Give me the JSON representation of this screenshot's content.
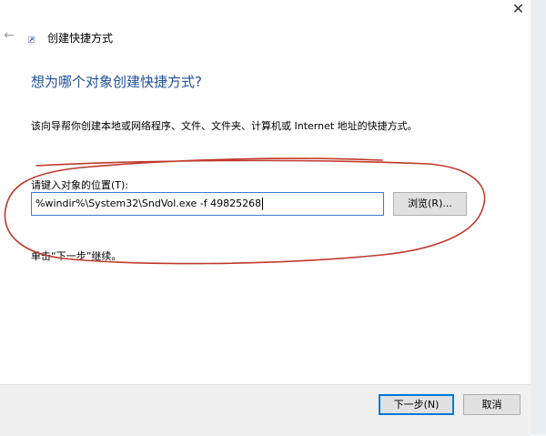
{
  "window": {
    "title": "创建快捷方式",
    "close_glyph": "✕",
    "back_glyph": "←"
  },
  "main": {
    "heading": "想为哪个对象创建快捷方式?",
    "description": "该向导帮你创建本地或网络程序、文件、文件夹、计算机或 Internet 地址的快捷方式。",
    "field_label": "请键入对象的位置(T):",
    "field_value": "%windir%\\System32\\SndVol.exe -f 49825268",
    "browse_label": "浏览(R)...",
    "hint": "单击“下一步”继续。"
  },
  "footer": {
    "next_label": "下一步(N)",
    "cancel_label": "取消"
  },
  "colors": {
    "heading": "#1e4e9d",
    "annotation": "#c0392b",
    "accent": "#0078d7"
  },
  "icons": {
    "back": "arrow-left-icon",
    "close": "close-icon",
    "app": "shortcut-wizard-icon"
  }
}
